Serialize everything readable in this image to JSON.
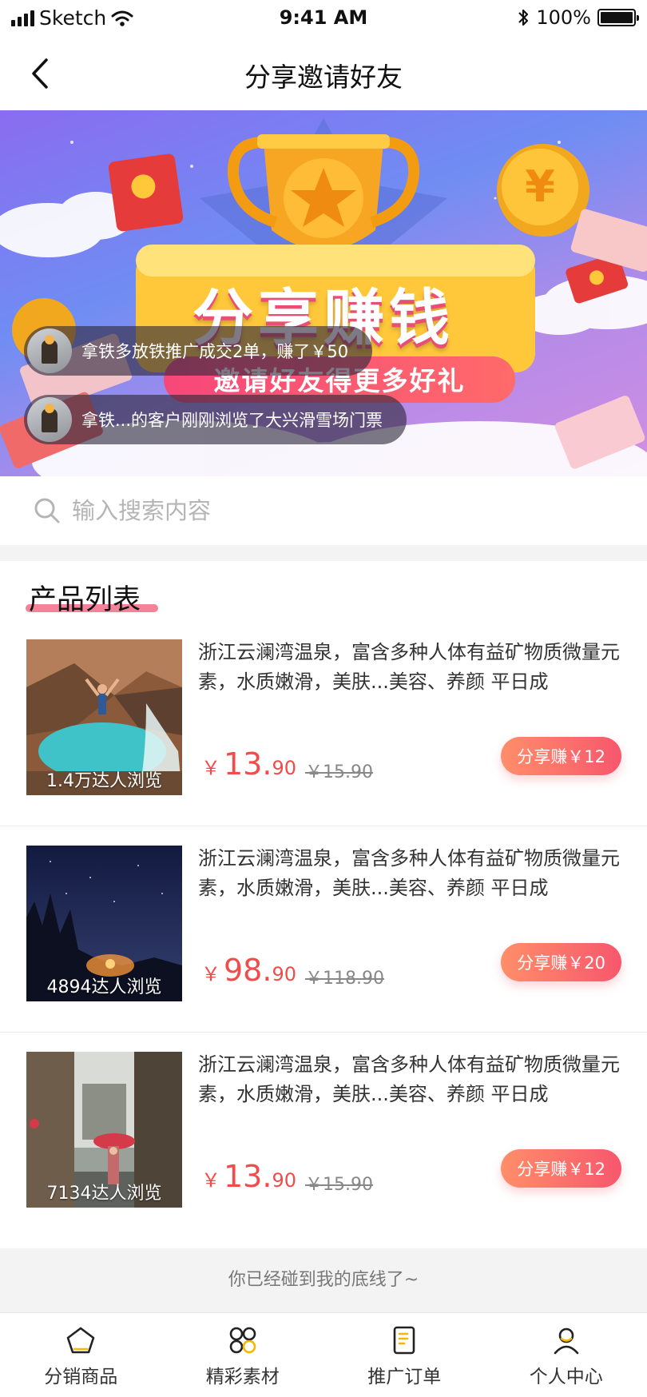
{
  "status_bar": {
    "carrier": "Sketch",
    "time": "9:41 AM",
    "battery": "100%"
  },
  "nav": {
    "title": "分享邀请好友"
  },
  "banner": {
    "title": "分享赚钱",
    "subtitle": "邀请好友得更多好礼",
    "notices": [
      {
        "text": "拿铁多放铁推广成交2单，赚了￥50"
      },
      {
        "text": "拿铁...的客户刚刚浏览了大兴滑雪场门票"
      }
    ]
  },
  "search": {
    "placeholder": "输入搜索内容"
  },
  "section": {
    "title": "产品列表"
  },
  "products": [
    {
      "views": "1.4万达人浏览",
      "description": "浙江云澜湾温泉，富含多种人体有益矿物质微量元素，水质嫩滑，美肤...美容、养颜 平日成",
      "currency": "￥",
      "price_int": "13.",
      "price_dec": "90",
      "original_price": "￥15.90",
      "share_label": "分享赚￥12"
    },
    {
      "views": "4894达人浏览",
      "description": "浙江云澜湾温泉，富含多种人体有益矿物质微量元素，水质嫩滑，美肤...美容、养颜 平日成",
      "currency": "￥",
      "price_int": "98.",
      "price_dec": "90",
      "original_price": "￥118.90",
      "share_label": "分享赚￥20"
    },
    {
      "views": "7134达人浏览",
      "description": "浙江云澜湾温泉，富含多种人体有益矿物质微量元素，水质嫩滑，美肤...美容、养颜 平日成",
      "currency": "￥",
      "price_int": "13.",
      "price_dec": "90",
      "original_price": "￥15.90",
      "share_label": "分享赚￥12"
    }
  ],
  "footer_note": "你已经碰到我的底线了~",
  "tabs": [
    {
      "label": "分销商品",
      "icon": "pentagon-icon"
    },
    {
      "label": "精彩素材",
      "icon": "grid-icon"
    },
    {
      "label": "推广订单",
      "icon": "document-icon"
    },
    {
      "label": "个人中心",
      "icon": "person-icon"
    }
  ],
  "colors": {
    "accent": "#f14b4b",
    "button_gradient_start": "#ff8e69",
    "button_gradient_end": "#f7576d",
    "heading_underline": "#f36c87"
  }
}
